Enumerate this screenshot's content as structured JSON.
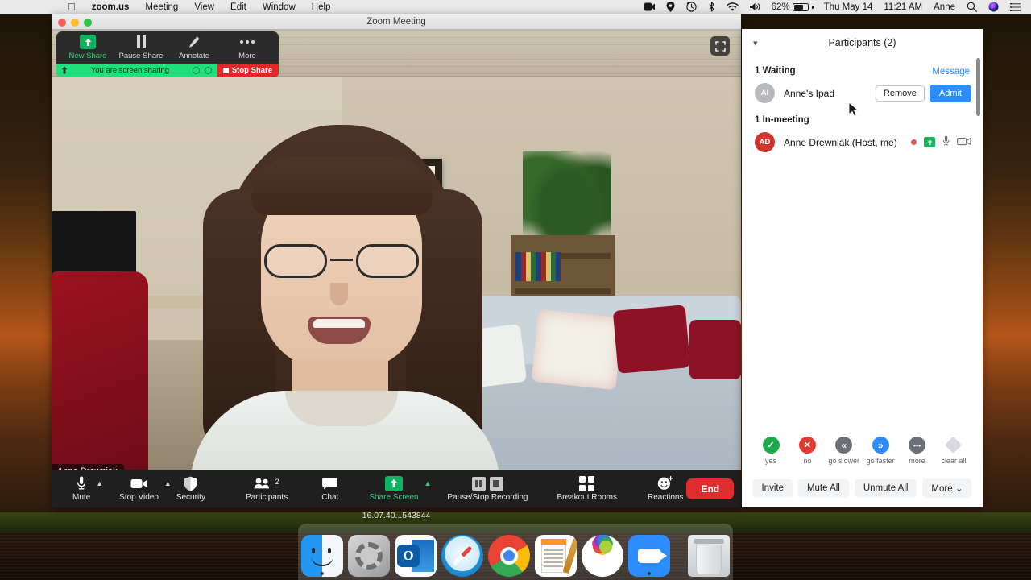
{
  "menubar": {
    "apple_icon": "apple-icon",
    "items": [
      "zoom.us",
      "Meeting",
      "View",
      "Edit",
      "Window",
      "Help"
    ],
    "status": {
      "screen_record_icon": "screen-record-icon",
      "location_icon": "location-icon",
      "time_machine_icon": "time-machine-icon",
      "bluetooth_icon": "bluetooth-icon",
      "wifi_icon": "wifi-icon",
      "volume_icon": "volume-icon",
      "battery_percent": "62%",
      "date": "Thu May 14",
      "time": "11:21 AM",
      "user": "Anne",
      "search_icon": "search-icon",
      "siri_icon": "siri-icon",
      "control_center_icon": "control-center-icon"
    }
  },
  "window": {
    "title": "Zoom Meeting"
  },
  "share_toolbar": {
    "buttons": [
      {
        "label": "New Share",
        "icon": "up-arrow-icon",
        "active": true
      },
      {
        "label": "Pause Share",
        "icon": "pause-icon",
        "active": false
      },
      {
        "label": "Annotate",
        "icon": "pencil-icon",
        "active": false
      },
      {
        "label": "More",
        "icon": "ellipsis-icon",
        "active": false
      }
    ],
    "status_text": "You are screen sharing",
    "stop_label": "Stop Share"
  },
  "video": {
    "participant_name": "Anne Drewniak",
    "fullscreen_icon": "fullscreen-icon"
  },
  "toolbar": {
    "buttons": [
      {
        "label": "Mute",
        "icon": "microphone-icon",
        "caret": true
      },
      {
        "label": "Stop Video",
        "icon": "video-camera-icon",
        "caret": true
      },
      {
        "label": "Security",
        "icon": "shield-icon",
        "caret": false
      },
      {
        "label": "Participants",
        "icon": "people-icon",
        "caret": false,
        "count": "2"
      },
      {
        "label": "Chat",
        "icon": "speech-bubble-icon",
        "caret": false
      },
      {
        "label": "Share Screen",
        "icon": "up-arrow-icon",
        "caret": true,
        "green": true
      },
      {
        "label": "Pause/Stop Recording",
        "icon": "pause-stop-icon",
        "caret": false
      },
      {
        "label": "Breakout Rooms",
        "icon": "grid-icon",
        "caret": false
      },
      {
        "label": "Reactions",
        "icon": "smiley-plus-icon",
        "caret": false
      }
    ],
    "end_label": "End"
  },
  "share_id": "16.07.40...543844",
  "participants_panel": {
    "title": "Participants (2)",
    "collapse_icon": "chevron-down-icon",
    "waiting": {
      "section_label": "1 Waiting",
      "message_link": "Message",
      "rows": [
        {
          "initials": "AI",
          "name": "Anne's Ipad",
          "remove_label": "Remove",
          "admit_label": "Admit"
        }
      ]
    },
    "in_meeting": {
      "section_label": "1 In-meeting",
      "rows": [
        {
          "initials": "AD",
          "name": "Anne Drewniak (Host, me)",
          "icons": [
            "recording-dot-icon",
            "screen-share-icon",
            "microphone-icon",
            "video-camera-icon"
          ]
        }
      ]
    },
    "reactions": [
      {
        "label": "yes",
        "icon": "check-circle-icon",
        "color": "#1ba94c",
        "glyph": "✓"
      },
      {
        "label": "no",
        "icon": "x-circle-icon",
        "color": "#e03a32",
        "glyph": "✕"
      },
      {
        "label": "go slower",
        "icon": "double-left-icon",
        "color": "#6b7076",
        "glyph": "«"
      },
      {
        "label": "go faster",
        "icon": "double-right-icon",
        "color": "#2d8cff",
        "glyph": "»"
      },
      {
        "label": "more",
        "icon": "ellipsis-circle-icon",
        "color": "#6b7076",
        "glyph": "•••"
      },
      {
        "label": "clear all",
        "icon": "clear-all-icon",
        "color": "#d6dade",
        "glyph": ""
      }
    ],
    "footer_buttons": [
      "Invite",
      "Mute All",
      "Unmute All",
      "More ⌄"
    ]
  },
  "dock": {
    "items": [
      {
        "name": "Finder",
        "icon": "finder-icon",
        "running": true
      },
      {
        "name": "System Preferences",
        "icon": "system-preferences-icon",
        "running": false
      },
      {
        "name": "Microsoft Outlook",
        "icon": "outlook-icon",
        "running": false
      },
      {
        "name": "Safari",
        "icon": "safari-icon",
        "running": false
      },
      {
        "name": "Google Chrome",
        "icon": "chrome-icon",
        "running": false
      },
      {
        "name": "Pages",
        "icon": "pages-icon",
        "running": false
      },
      {
        "name": "Photos",
        "icon": "photos-icon",
        "running": false
      },
      {
        "name": "Zoom",
        "icon": "zoom-icon",
        "running": true
      },
      {
        "name": "Trash",
        "icon": "trash-icon",
        "running": false
      }
    ]
  },
  "colors": {
    "zoom_blue": "#2d8cff",
    "share_green": "#1fe07a",
    "stop_red": "#e02828",
    "end_red": "#e02d2d",
    "toolbar_dark": "#1f1f1f"
  }
}
